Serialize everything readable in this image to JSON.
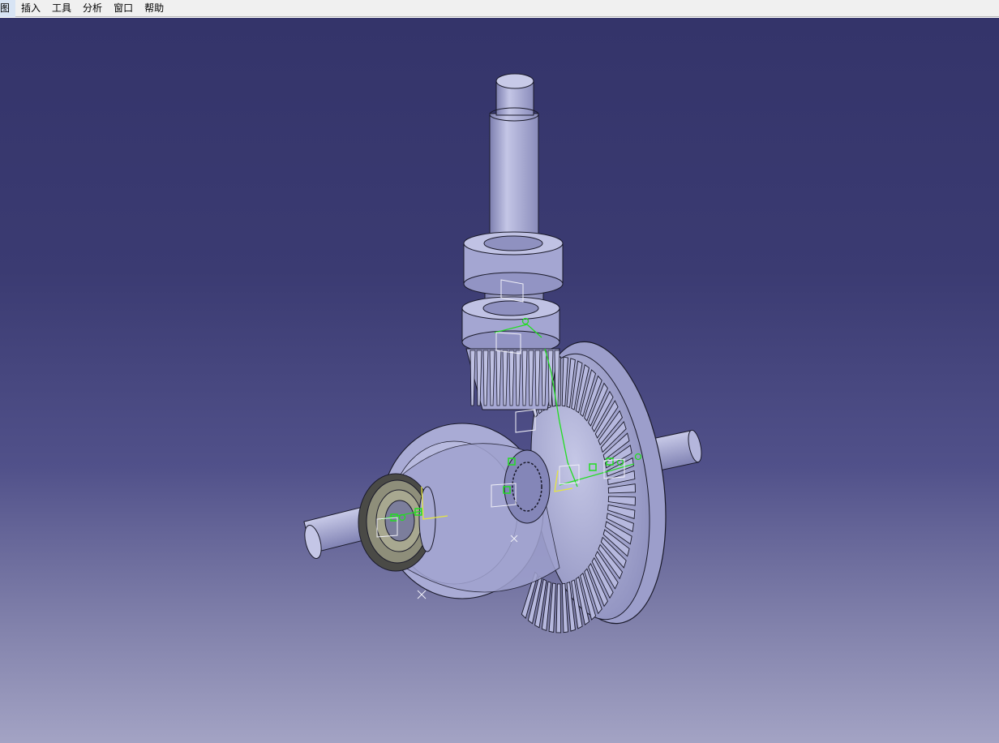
{
  "menubar": {
    "items": [
      {
        "label": "图"
      },
      {
        "label": "插入"
      },
      {
        "label": "工具"
      },
      {
        "label": "分析"
      },
      {
        "label": "窗口"
      },
      {
        "label": "帮助"
      }
    ]
  },
  "viewport": {
    "background_top": "#34346a",
    "background_bottom": "#a3a3c4",
    "model": "bevel-gear-differential-assembly",
    "part_color": "#aeb0d6",
    "edge_color": "#1a1a2a",
    "constraint_color": "#22dd22",
    "axis_color": "#e6e640"
  }
}
